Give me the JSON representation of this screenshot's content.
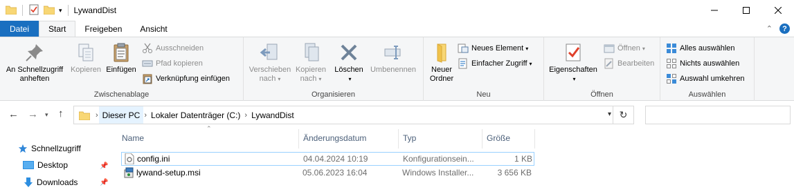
{
  "window": {
    "title": "LywandDist"
  },
  "tabs": [
    {
      "label": "Datei"
    },
    {
      "label": "Start"
    },
    {
      "label": "Freigeben"
    },
    {
      "label": "Ansicht"
    }
  ],
  "ribbon": {
    "clipboard": {
      "label": "Zwischenablage",
      "pin": "An Schnellzugriff\nanheften",
      "copy": "Kopieren",
      "paste": "Einfügen",
      "cut": "Ausschneiden",
      "copy_path": "Pfad kopieren",
      "paste_shortcut": "Verknüpfung einfügen"
    },
    "organize": {
      "label": "Organisieren",
      "move_to_1": "Verschieben",
      "move_to_2": "nach",
      "copy_to_1": "Kopieren",
      "copy_to_2": "nach",
      "delete": "Löschen",
      "rename": "Umbenennen"
    },
    "new": {
      "label": "Neu",
      "new_folder_1": "Neuer",
      "new_folder_2": "Ordner",
      "new_item": "Neues Element",
      "easy_access": "Einfacher Zugriff"
    },
    "open": {
      "label": "Öffnen",
      "properties": "Eigenschaften",
      "open": "Öffnen",
      "edit": "Bearbeiten"
    },
    "select": {
      "label": "Auswählen",
      "select_all": "Alles auswählen",
      "select_none": "Nichts auswählen",
      "invert": "Auswahl umkehren"
    }
  },
  "address": {
    "crumbs": [
      "Dieser PC",
      "Lokaler Datenträger (C:)",
      "LywandDist"
    ]
  },
  "navpane": {
    "items": [
      {
        "label": "Schnellzugriff",
        "icon": "star-icon"
      },
      {
        "label": "Desktop",
        "icon": "desktop-icon"
      },
      {
        "label": "Downloads",
        "icon": "download-icon"
      }
    ]
  },
  "filelist": {
    "columns": [
      "Name",
      "Änderungsdatum",
      "Typ",
      "Größe"
    ],
    "rows": [
      {
        "name": "config.ini",
        "date": "04.04.2024 10:19",
        "type": "Konfigurationsein...",
        "size": "1 KB"
      },
      {
        "name": "lywand-setup.msi",
        "date": "05.06.2023 16:04",
        "type": "Windows Installer...",
        "size": "3 656 KB"
      }
    ]
  },
  "colors": {
    "accent": "#1a6fc0",
    "ribbon_bg": "#f5f6f7",
    "folder": "#f8d775"
  }
}
